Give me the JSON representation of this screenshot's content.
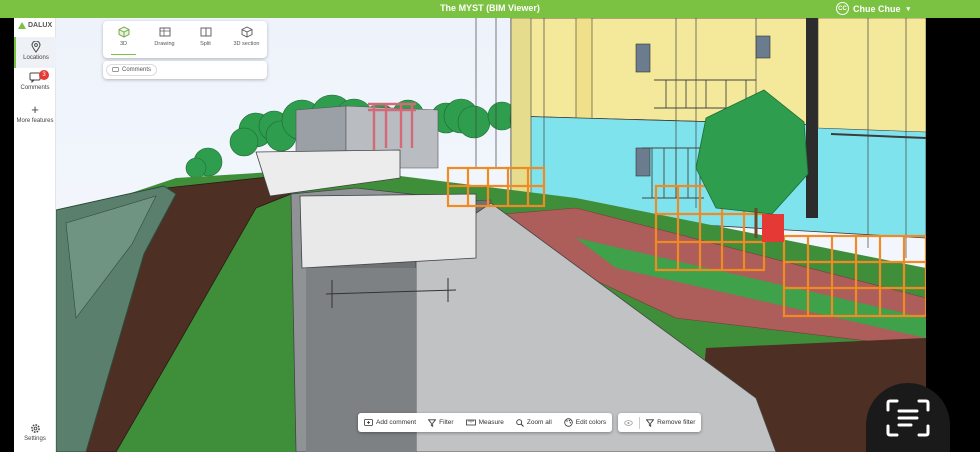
{
  "topbar": {
    "title": "The MYST (BIM Viewer)",
    "user_initials": "CC",
    "user_name": "Chue Chue"
  },
  "sidebar": {
    "logo": "DALUX",
    "items": [
      {
        "label": "Locations",
        "icon": "location-pin-icon",
        "active": true
      },
      {
        "label": "Comments",
        "icon": "comments-icon",
        "badge": "3"
      },
      {
        "label": "More features",
        "icon": "plus-icon"
      },
      {
        "label": "Settings",
        "icon": "gear-icon"
      }
    ]
  },
  "view_modes": [
    {
      "label": "3D",
      "icon": "cube-icon",
      "active": true
    },
    {
      "label": "Drawing",
      "icon": "drawing-icon"
    },
    {
      "label": "Split",
      "icon": "split-icon"
    },
    {
      "label": "3D section",
      "icon": "section-cube-icon"
    }
  ],
  "comments_filter": {
    "label": "Comments"
  },
  "toolbar": {
    "add_comment": "Add comment",
    "filter": "Filter",
    "measure": "Measure",
    "zoom_all": "Zoom all",
    "edit_colors": "Edit colors",
    "remove_filter": "Remove filter"
  },
  "colors": {
    "accent": "#7bc142",
    "badge": "#e53935",
    "scaffold": "#f08a24"
  }
}
